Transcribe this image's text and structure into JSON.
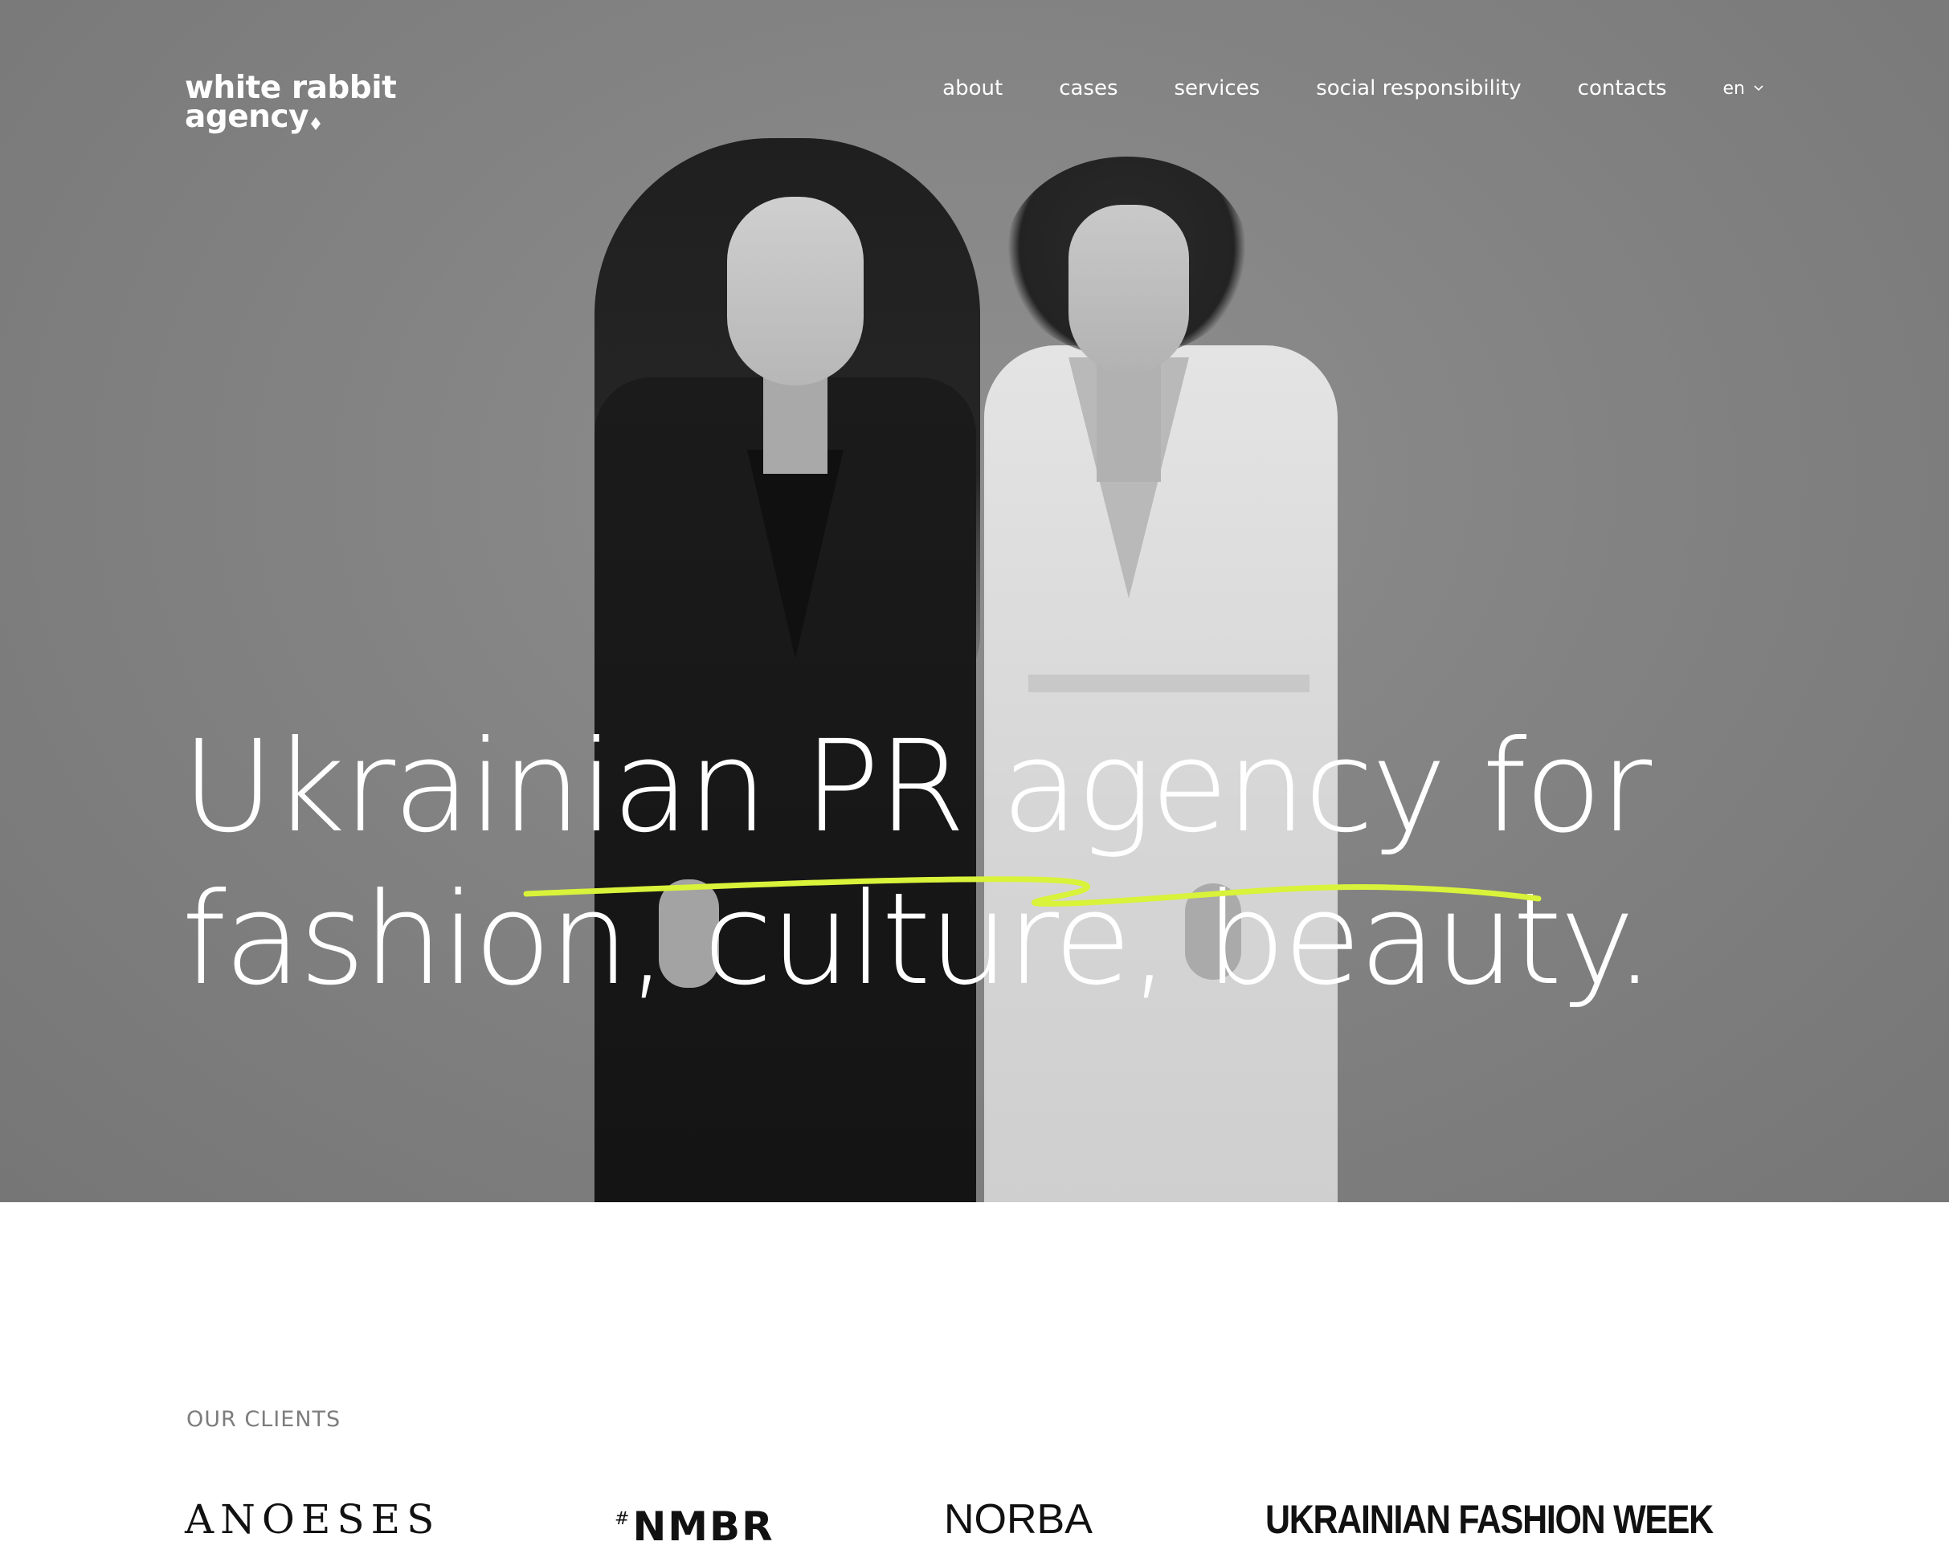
{
  "brand": {
    "logo_line1": "white rabbit",
    "logo_line2": "agency",
    "accent_color": "#d9f23a"
  },
  "nav": {
    "items": [
      {
        "label": "about"
      },
      {
        "label": "cases"
      },
      {
        "label": "services"
      },
      {
        "label": "social responsibility"
      },
      {
        "label": "contacts"
      }
    ],
    "language": "en"
  },
  "hero": {
    "headline_line1": "Ukrainian PR agency for",
    "headline_line2": "fashion, culture, beauty."
  },
  "clients": {
    "label": "OUR CLIENTS",
    "items": [
      {
        "name": "ANOESES"
      },
      {
        "prefix": "#",
        "name": "NMBR"
      },
      {
        "name": "NORBA"
      },
      {
        "name": "UKRAINIAN FASHION WEEK"
      }
    ]
  }
}
